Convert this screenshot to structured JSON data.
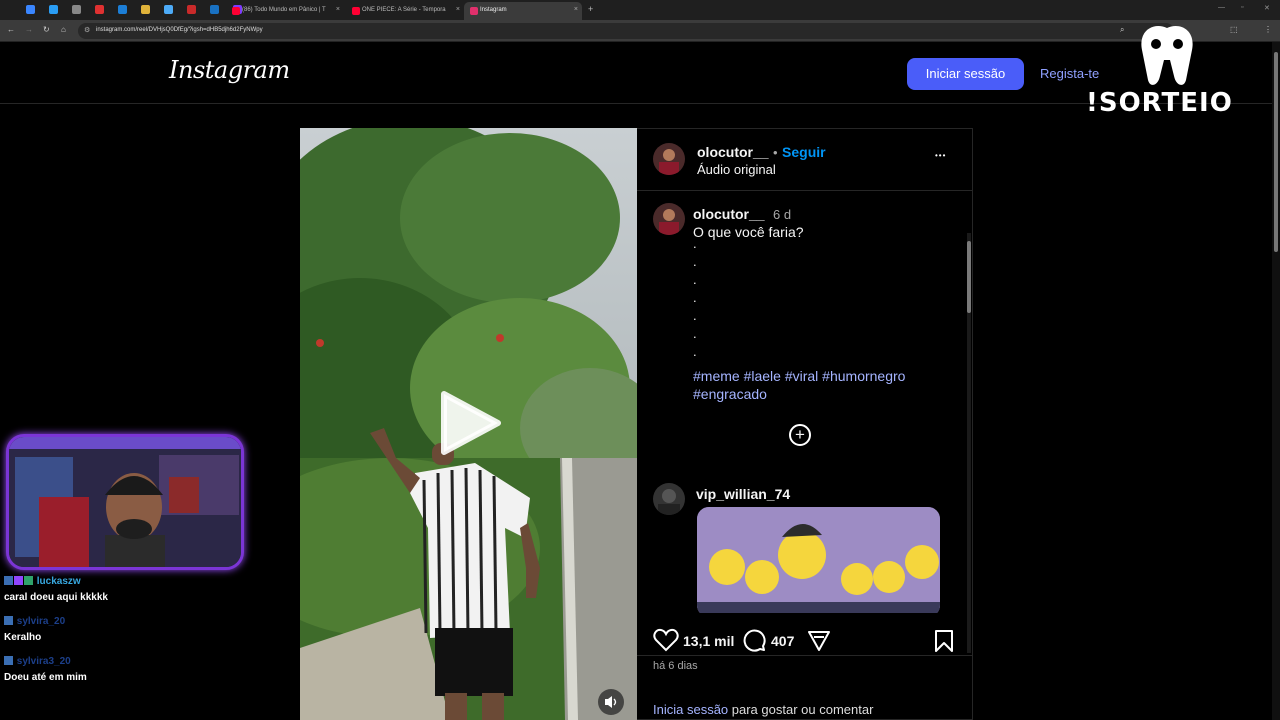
{
  "browser": {
    "tabs": [
      {
        "label": "(86) Todo Mundo em Pânico | T",
        "icon_color": "#ff0033"
      },
      {
        "label": "ONE PIECE: A Série - Tempora",
        "icon_color": "#ff0033"
      },
      {
        "label": "Instagram",
        "icon_color": "#e1306c"
      }
    ],
    "pinned_tab_colors": [
      "#3a86ff",
      "#2a9df4",
      "#888888",
      "#e03131",
      "#1c7ed6",
      "#e0b33a",
      "#4dabf7",
      "#c92a2a",
      "#1971c2",
      "#7d3cff"
    ],
    "url": "instagram.com/reel/DVHjsQ0DfEg/?igsh=dHB5djh6d2FyNWpy",
    "new_tab_symbol": "+",
    "close_symbol": "×"
  },
  "header": {
    "logo": "Instagram",
    "login_button": "Iniciar sessão",
    "register_link": "Regista-te"
  },
  "post": {
    "author": "olocutor__",
    "follow_separator": "•",
    "follow": "Seguir",
    "audio": "Áudio original",
    "more": "•••",
    "caption_author": "olocutor__",
    "caption_age": "6 d",
    "caption_text": "O que você faria?",
    "caption_dots": [
      ".",
      ".",
      ".",
      ".",
      ".",
      ".",
      "."
    ],
    "hashtags_line1": "#meme #laele #viral #humornegro",
    "hashtags_line2": "#engracado",
    "add_comment_symbol": "+",
    "comment_author": "vip_willian_74",
    "likes": "13,1 mil",
    "comments": "407",
    "date": "há 6 dias",
    "login_prompt_link": "Inicia sessão",
    "login_prompt_rest": " para gostar ou comentar"
  },
  "stream": {
    "chat": [
      {
        "name": "luckaszw",
        "message": "caral doeu aqui kkkkk"
      },
      {
        "name": "sylvira_20",
        "message": "Keralho"
      },
      {
        "name": "sylvira3_20",
        "message": "Doeu até em mim"
      }
    ],
    "sorteio": "!SORTEIO"
  },
  "colors": {
    "primary_button": "#4a5df9",
    "link_blue": "#0095f6",
    "hashtag": "#a5b4ff",
    "webcam_border": "#7b35d6"
  }
}
